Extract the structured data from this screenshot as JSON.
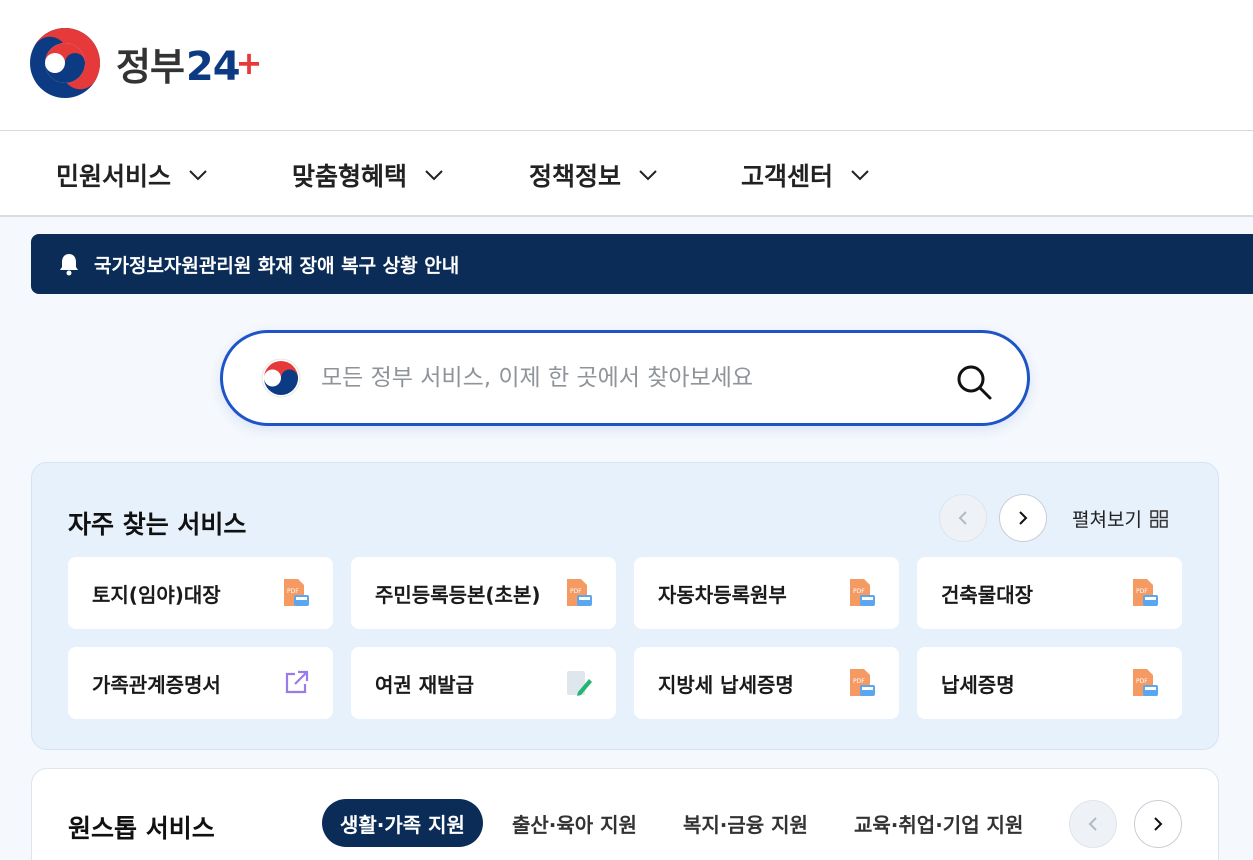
{
  "header": {
    "logo_text": "정부",
    "logo_num": "24",
    "logo_plus": "+"
  },
  "gnb": {
    "items": [
      {
        "label": "민원서비스"
      },
      {
        "label": "맞춤형혜택"
      },
      {
        "label": "정책정보"
      },
      {
        "label": "고객센터"
      }
    ]
  },
  "notice": {
    "text": "국가정보자원관리원 화재 장애 복구 상황 안내"
  },
  "search": {
    "placeholder": "모든 정부 서비스, 이제 한 곳에서 찾아보세요",
    "value": ""
  },
  "frequent": {
    "title": "자주 찾는 서비스",
    "expand_label": "펼쳐보기",
    "cards": [
      {
        "label": "토지(임야)대장",
        "icon": "pdf-doc-icon"
      },
      {
        "label": "주민등록등본(초본)",
        "icon": "pdf-doc-icon"
      },
      {
        "label": "자동차등록원부",
        "icon": "pdf-doc-icon"
      },
      {
        "label": "건축물대장",
        "icon": "pdf-doc-icon"
      },
      {
        "label": "가족관계증명서",
        "icon": "external-link-icon"
      },
      {
        "label": "여권 재발급",
        "icon": "edit-doc-icon"
      },
      {
        "label": "지방세 납세증명",
        "icon": "pdf-doc-icon"
      },
      {
        "label": "납세증명",
        "icon": "pdf-doc-icon"
      }
    ]
  },
  "onestop": {
    "title": "원스톱 서비스",
    "tabs": [
      {
        "label": "생활·가족 지원",
        "active": true
      },
      {
        "label": "출산·육아 지원",
        "active": false
      },
      {
        "label": "복지·금융 지원",
        "active": false
      },
      {
        "label": "교육·취업·기업 지원",
        "active": false
      }
    ]
  },
  "colors": {
    "brand_navy": "#0b2c57",
    "search_border": "#1e54c8",
    "section_bg": "#e7f1fc"
  }
}
